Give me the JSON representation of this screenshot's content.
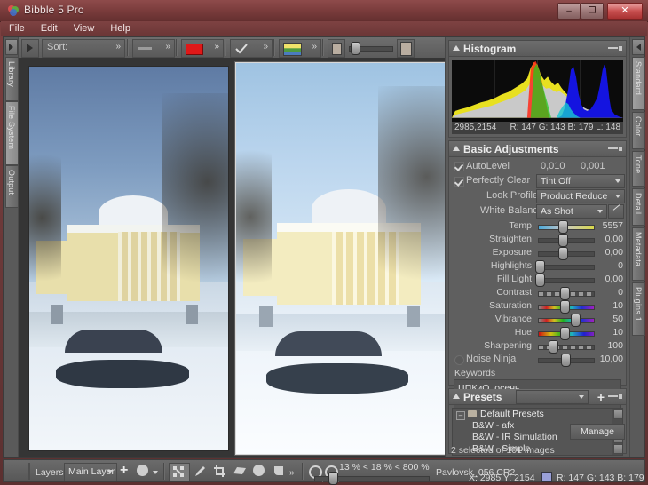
{
  "window": {
    "title": "Bibble 5 Pro",
    "icon": "app-icon",
    "minimize": "–",
    "maximize": "❐",
    "close": "✕"
  },
  "menu": [
    "File",
    "Edit",
    "View",
    "Help"
  ],
  "toolbar": {
    "sort_label": "Sort:",
    "chevron": "»",
    "items": [
      "sort",
      "rating-separator",
      "color-label-red",
      "check-flag",
      "filmstrip-view",
      "thumb-size"
    ]
  },
  "left_rail": {
    "collapse_icon": "triangle-right-icon",
    "tabs": [
      {
        "label": "Library",
        "active": false
      },
      {
        "label": "File System",
        "active": true
      },
      {
        "label": "Output",
        "active": false
      }
    ]
  },
  "right_rail": {
    "collapse_icon": "triangle-left-icon",
    "tabs": [
      {
        "label": "Standard",
        "active": true
      },
      {
        "label": "Color",
        "active": false
      },
      {
        "label": "Tone",
        "active": false
      },
      {
        "label": "Detail",
        "active": false
      },
      {
        "label": "Metadata",
        "active": false
      },
      {
        "label": "Plugins 1",
        "active": false
      }
    ]
  },
  "viewer": {
    "images": [
      {
        "name": "left-preview",
        "selected": false,
        "bright": false
      },
      {
        "name": "right-preview",
        "selected": true,
        "bright": true
      }
    ]
  },
  "histogram": {
    "title": "Histogram",
    "coords": "2985,2154",
    "readout": "R: 147  G: 143  B: 179  L: 148"
  },
  "basic_adjustments": {
    "title": "Basic Adjustments",
    "autolevel": {
      "label": "AutoLevel",
      "checked": true,
      "value1": "0,010",
      "value2": "0,001"
    },
    "perfectly_clear": {
      "label": "Perfectly Clear",
      "checked": true,
      "tint": "Tint Off"
    },
    "look_profile": {
      "label": "Look Profile",
      "value": "Product Reduce"
    },
    "white_balance": {
      "label": "White Balance",
      "value": "As Shot",
      "picker": "eyedropper-icon"
    },
    "sliders": [
      {
        "label": "Temp",
        "value": "5557",
        "pos": 44,
        "track": "temp"
      },
      {
        "label": "Straighten",
        "value": "0,00",
        "pos": 44,
        "track": "plain"
      },
      {
        "label": "Exposure",
        "value": "0,00",
        "pos": 44,
        "track": "plain"
      },
      {
        "label": "Highlights",
        "value": "0",
        "pos": 2,
        "track": "plain"
      },
      {
        "label": "Fill Light",
        "value": "0,00",
        "pos": 2,
        "track": "plain"
      },
      {
        "label": "Contrast",
        "value": "0",
        "pos": 47,
        "track": "dashed"
      },
      {
        "label": "Saturation",
        "value": "10",
        "pos": 47,
        "track": "sat"
      },
      {
        "label": "Vibrance",
        "value": "50",
        "pos": 66,
        "track": "sat"
      },
      {
        "label": "Hue",
        "value": "10",
        "pos": 47,
        "track": "hue"
      },
      {
        "label": "Sharpening",
        "value": "100",
        "pos": 26,
        "track": "dashed"
      }
    ],
    "noise_ninja": {
      "label": "Noise Ninja",
      "checked": false,
      "value": "10,00",
      "pos": 44
    },
    "keywords_label": "Keywords",
    "keywords_value": "ЦПКиО, осень,"
  },
  "presets": {
    "title": "Presets",
    "add_icon": "plus-icon",
    "dropdown_value": "",
    "root": "Default Presets",
    "items": [
      "B&W - afx",
      "B&W - IR Simulation",
      "B&W - Simple"
    ],
    "manage_label": "Manage",
    "selection_status": "2 selected of 101 images"
  },
  "status_bar": {
    "layers_label": "Layers",
    "layer_value": "Main Layer",
    "add_icon": "plus-icon",
    "tools": [
      "fit-icon",
      "pencil-icon",
      "crop-icon",
      "perspective-icon",
      "circle-icon",
      "gradient-icon"
    ],
    "chevron": "»",
    "zoom_out_icon": "zoom-out-icon",
    "zoom_in_icon": "zoom-in-icon",
    "zoom_text": "13 % < 18 % < 800 %",
    "filename": "Pavlovsk_056.CR2",
    "coords": "X: 2985  Y: 2154",
    "rgb": "R: 147   G: 143   B: 179",
    "swatch_color": "#9aa0d8"
  }
}
